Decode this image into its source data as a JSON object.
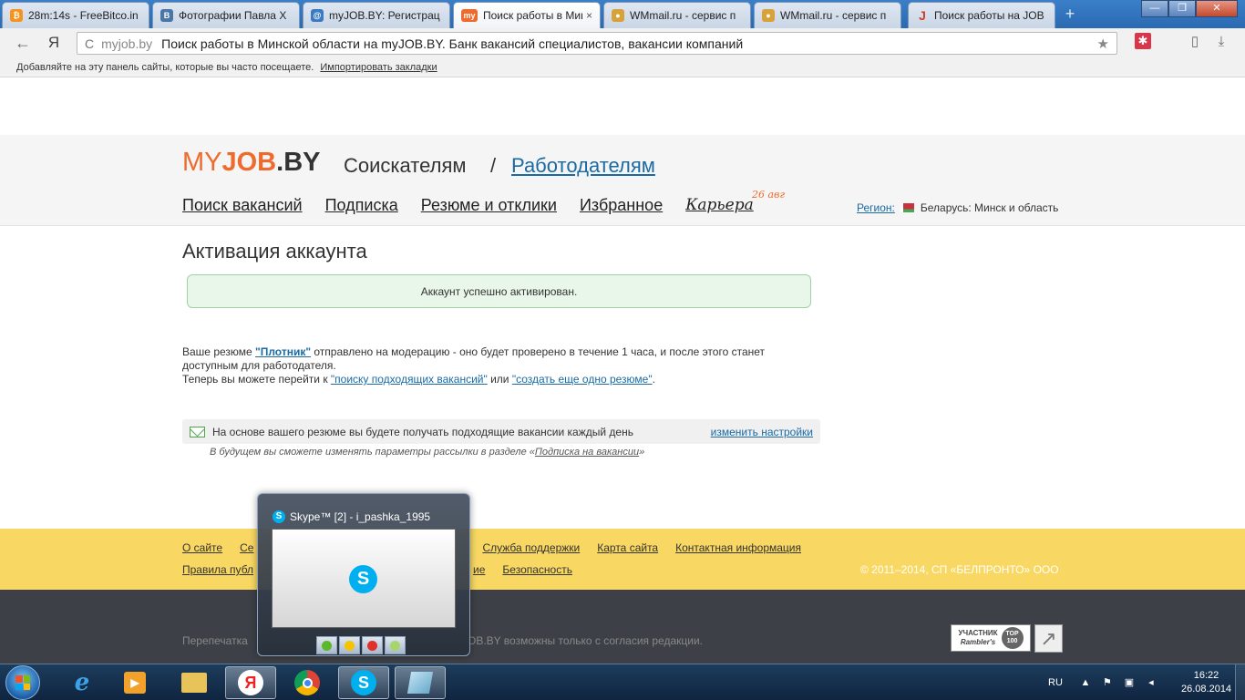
{
  "browser": {
    "tabs": [
      {
        "label": "28m:14s - FreeBitco.in",
        "icon": "bitcoin-icon",
        "fav_color": "#f7931a",
        "fav_text": "₿"
      },
      {
        "label": "Фотографии Павла Х",
        "icon": "vk-icon",
        "fav_color": "#4a76a8",
        "fav_text": "B"
      },
      {
        "label": "myJOB.BY: Регистрац",
        "icon": "webmoney-icon",
        "fav_color": "#3b7bc4",
        "fav_text": "@"
      },
      {
        "label": "Поиск работы в Мин",
        "icon": "myjob-icon",
        "fav_color": "#ef6b2d",
        "fav_text": "my"
      },
      {
        "label": "WMmail.ru - сервис п",
        "icon": "wmmail-icon",
        "fav_color": "#d8a23a",
        "fav_text": "●"
      },
      {
        "label": "WMmail.ru - сервис п",
        "icon": "wmmail-icon",
        "fav_color": "#d8a23a",
        "fav_text": "●"
      },
      {
        "label": "Поиск работы на JOB",
        "icon": "job-icon",
        "fav_color": "#d33c27",
        "fav_text": "J"
      }
    ],
    "tab_close": "×",
    "new_tab": "+",
    "window": {
      "minimize": "—",
      "maximize": "❐",
      "close": "✕"
    },
    "back": "←",
    "yandex": "Я",
    "omnibox": {
      "reload": "C",
      "host": "myjob.by",
      "title": "Поиск работы в Минской области на myJOB.BY. Банк вакансий специалистов, вакансии компаний",
      "star": "★"
    },
    "bookmarks_bar": {
      "text": "Добавляйте на эту панель сайты, которые вы часто посещаете.",
      "import_link": "Импортировать закладки"
    }
  },
  "site": {
    "logo": {
      "my": "MY",
      "job": "JOB",
      "dot_by": ".BY"
    },
    "seekers": "Соискателям",
    "slash": "/",
    "employers": "Работодателям",
    "nav": [
      "Поиск вакансий",
      "Подписка",
      "Резюме и отклики",
      "Избранное"
    ],
    "career": "Карьера",
    "career_date": "26 авг",
    "region_label": "Регион:",
    "region_value": "Беларусь: Минск и область"
  },
  "main": {
    "title": "Активация аккаунта",
    "success": "Аккаунт успешно активирован.",
    "msg_part1": "Ваше резюме ",
    "resume_name": "\"Плотник\"",
    "msg_part2": " отправлено на модерацию - оно будет проверено в течение 1 часа, и после этого станет доступным для работодателя.",
    "msg_part3": "Теперь вы можете перейти к ",
    "link_search": "\"поиску подходящих вакансий\"",
    "msg_or": " или ",
    "link_create": "\"создать еще одно резюме\"",
    "msg_end": ".",
    "subscribe_text": "На основе вашего резюме вы будете получать подходящие вакансии каждый день",
    "subscribe_link": "изменить настройки",
    "note_part1": "В будущем вы сможете изменять параметры рассылки в разделе «",
    "note_link": "Подписка на вакансии",
    "note_part2": "»"
  },
  "footer": {
    "row1": [
      "О сайте",
      "Се",
      "Служба поддержки",
      "Карта сайта",
      "Контактная информация"
    ],
    "row2": [
      "Правила публ",
      "ие",
      "Безопасность"
    ],
    "copyright": "© 2011–2014, СП «БЕЛПРОНТО» ООО",
    "reprint_start": "Перепечатка",
    "reprint_end": "OB.BY возможны только с согласия редакции.",
    "rambler_line1": "УЧАСТНИК",
    "rambler_line2": "Rambler's",
    "rambler_top": "TOP 100"
  },
  "skype_popup": {
    "title": "Skype™ [2] - i_pashka_1995",
    "logo": "S"
  },
  "taskbar": {
    "apps": [
      "internet-explorer-icon",
      "media-player-icon",
      "explorer-folder-icon",
      "yandex-browser-icon",
      "chrome-icon",
      "skype-icon",
      "notepad-icon"
    ],
    "lang": "RU",
    "time": "16:22",
    "date": "26.08.2014"
  },
  "colors": {
    "accent_orange": "#ef6b2d",
    "link_blue": "#1a6aa3",
    "footer_yellow": "#f8d863",
    "footer_dark": "#3d4147",
    "success_bg": "#e9f7ea"
  }
}
